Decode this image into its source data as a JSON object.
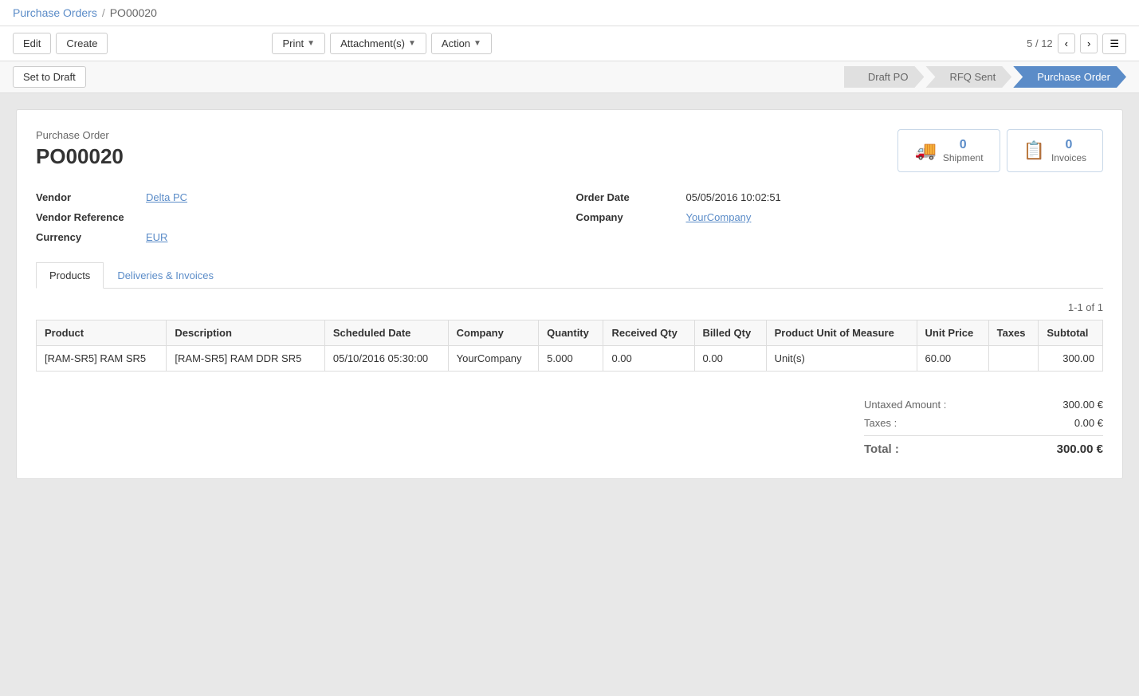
{
  "breadcrumb": {
    "parent_label": "Purchase Orders",
    "separator": "/",
    "current": "PO00020"
  },
  "toolbar": {
    "edit_label": "Edit",
    "create_label": "Create",
    "print_label": "Print",
    "attachments_label": "Attachment(s)",
    "action_label": "Action",
    "pagination": "5 / 12"
  },
  "status_bar": {
    "set_to_draft_label": "Set to Draft",
    "steps": [
      {
        "label": "Draft PO",
        "active": false
      },
      {
        "label": "RFQ Sent",
        "active": false
      },
      {
        "label": "Purchase Order",
        "active": true
      }
    ]
  },
  "form": {
    "subtitle": "Purchase Order",
    "title": "PO00020",
    "smart_buttons": [
      {
        "id": "shipment",
        "icon": "🚚",
        "count": "0",
        "label": "Shipment"
      },
      {
        "id": "invoices",
        "icon": "📄",
        "count": "0",
        "label": "Invoices"
      }
    ],
    "fields_left": [
      {
        "label": "Vendor",
        "value": "Delta PC",
        "is_link": true
      },
      {
        "label": "Vendor Reference",
        "value": "",
        "is_link": false
      },
      {
        "label": "Currency",
        "value": "EUR",
        "is_link": true
      }
    ],
    "fields_right": [
      {
        "label": "Order Date",
        "value": "05/05/2016 10:02:51",
        "is_link": false
      },
      {
        "label": "Company",
        "value": "YourCompany",
        "is_link": true
      }
    ],
    "tabs": [
      {
        "label": "Products",
        "active": true
      },
      {
        "label": "Deliveries & Invoices",
        "active": false
      }
    ],
    "table": {
      "pagination": "1-1 of 1",
      "columns": [
        {
          "key": "product",
          "label": "Product"
        },
        {
          "key": "description",
          "label": "Description"
        },
        {
          "key": "scheduled_date",
          "label": "Scheduled Date"
        },
        {
          "key": "company",
          "label": "Company"
        },
        {
          "key": "quantity",
          "label": "Quantity"
        },
        {
          "key": "received_qty",
          "label": "Received Qty"
        },
        {
          "key": "billed_qty",
          "label": "Billed Qty"
        },
        {
          "key": "product_uom",
          "label": "Product Unit of Measure"
        },
        {
          "key": "unit_price",
          "label": "Unit Price"
        },
        {
          "key": "taxes",
          "label": "Taxes"
        },
        {
          "key": "subtotal",
          "label": "Subtotal"
        }
      ],
      "rows": [
        {
          "product": "[RAM-SR5] RAM SR5",
          "description": "[RAM-SR5] RAM DDR SR5",
          "scheduled_date": "05/10/2016 05:30:00",
          "company": "YourCompany",
          "quantity": "5.000",
          "received_qty": "0.00",
          "billed_qty": "0.00",
          "product_uom": "Unit(s)",
          "unit_price": "60.00",
          "taxes": "",
          "subtotal": "300.00"
        }
      ]
    },
    "totals": {
      "untaxed_label": "Untaxed Amount :",
      "untaxed_value": "300.00 €",
      "taxes_label": "Taxes :",
      "taxes_value": "0.00 €",
      "total_label": "Total :",
      "total_value": "300.00 €"
    }
  }
}
